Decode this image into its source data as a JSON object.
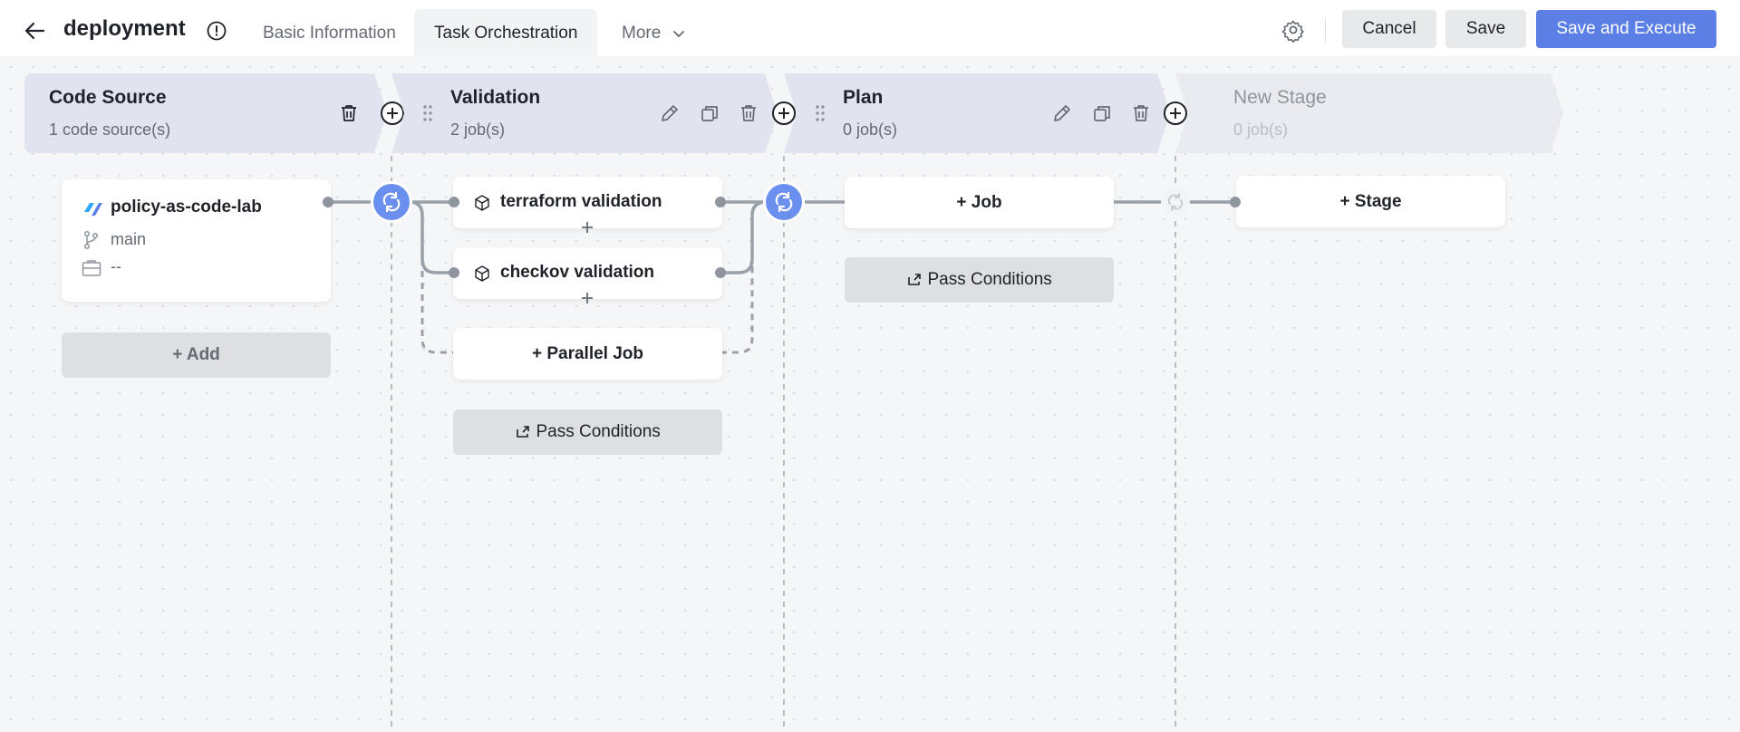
{
  "header": {
    "title": "deployment",
    "tabs": [
      {
        "label": "Basic Information",
        "active": false
      },
      {
        "label": "Task Orchestration",
        "active": true
      },
      {
        "label": "More",
        "active": false
      }
    ],
    "buttons": {
      "cancel": "Cancel",
      "save": "Save",
      "save_execute": "Save and Execute"
    }
  },
  "stages": [
    {
      "name": "Code Source",
      "count": "1 code source(s)"
    },
    {
      "name": "Validation",
      "count": "2 job(s)"
    },
    {
      "name": "Plan",
      "count": "0 job(s)"
    },
    {
      "name": "New Stage",
      "count": "0 job(s)"
    }
  ],
  "code_source": {
    "repo": "policy-as-code-lab",
    "branch": "main",
    "path": "--",
    "add_label": "Add"
  },
  "validation": {
    "jobs": [
      "terraform validation",
      "checkov validation"
    ],
    "parallel_job_label": "Parallel Job",
    "pass_conditions_label": "Pass Conditions"
  },
  "plan": {
    "job_label": "Job",
    "pass_conditions_label": "Pass Conditions"
  },
  "new_stage": {
    "stage_label": "Stage"
  },
  "icons": {
    "back": "arrow-left-icon",
    "info": "info-circle-icon",
    "settings": "gear-icon",
    "edit": "pencil-icon",
    "copy": "copy-icon",
    "delete": "trash-icon",
    "drag": "drag-handle-icon",
    "add": "plus-circle-icon",
    "job": "cube-icon",
    "branch": "branch-icon",
    "folder": "folder-icon",
    "pass": "share-icon"
  },
  "colors": {
    "accent": "#5b7fe4",
    "node": "#6a8fee",
    "stage_header": "#e1e4ee",
    "line": "#8f959e"
  }
}
